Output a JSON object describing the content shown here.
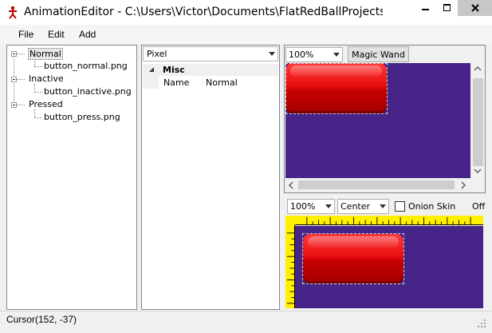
{
  "window": {
    "title": "AnimationEditor - C:\\Users\\Victor\\Documents\\FlatRedBallProjects\\Glu..."
  },
  "menu": {
    "items": [
      {
        "label": "File"
      },
      {
        "label": "Edit"
      },
      {
        "label": "Add"
      }
    ]
  },
  "tree": {
    "nodes": [
      {
        "label": "Normal",
        "selected": true,
        "children": [
          "button_normal.png"
        ]
      },
      {
        "label": "Inactive",
        "children": [
          "button_inactive.png"
        ]
      },
      {
        "label": "Pressed",
        "children": [
          "button_press.png"
        ]
      }
    ]
  },
  "properties": {
    "selected_object": "Pixel",
    "category": "Misc",
    "rows": [
      {
        "name": "Name",
        "value": "Normal"
      }
    ]
  },
  "upper_view": {
    "zoom": "100%",
    "magic_wand_label": "Magic Wand"
  },
  "lower_view": {
    "zoom": "100%",
    "alignment": "Center",
    "onion_skin_label": "Onion Skin",
    "onion_skin_checked": false,
    "offset_truncated": "Off"
  },
  "status": {
    "cursor": "Cursor(152, -37)"
  },
  "colors": {
    "canvas_background": "#472488",
    "ruler": "#ffef00",
    "sprite_red": "#d40000"
  }
}
